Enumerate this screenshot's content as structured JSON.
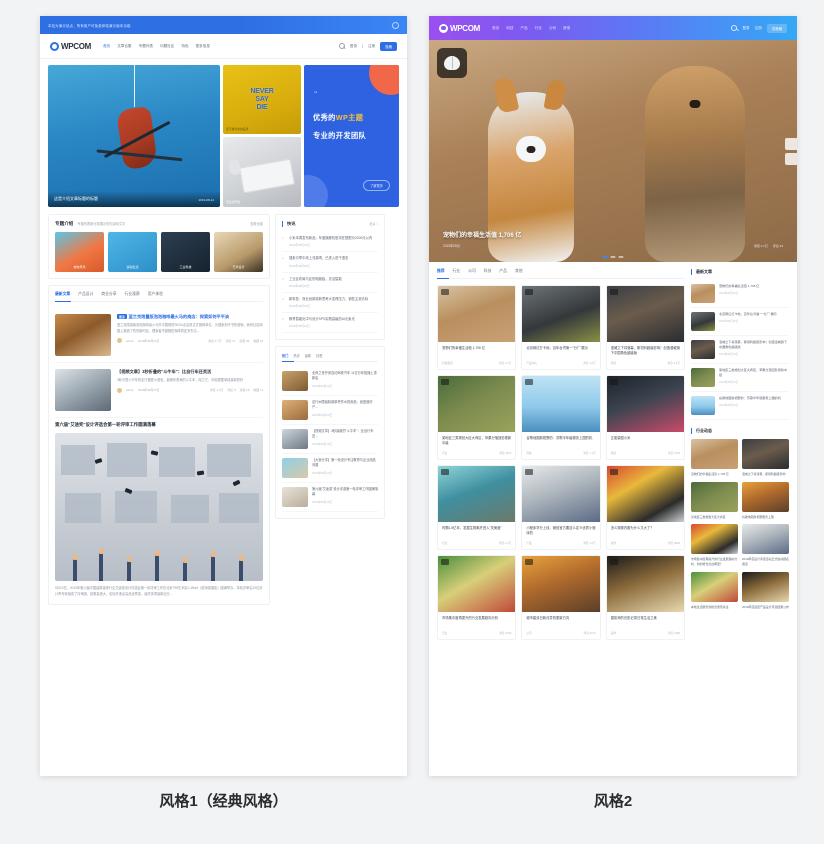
{
  "captions": {
    "style1": "风格1（经典风格）",
    "style2": "风格2"
  },
  "style1": {
    "notice": "本站为演示站点，所有用户可免费体验演示版本功能",
    "brand": "WPCOM",
    "menu": [
      "首页",
      "文章合集",
      "专题列表",
      "问题社区",
      "特色",
      "更多信息"
    ],
    "nav_right": {
      "login": "登录",
      "sep": "|",
      "register": "注册",
      "cta": "投稿"
    },
    "hero": {
      "main_title": "这是介绍文章标题的标题",
      "main_date": "2019-08-12",
      "card_never": {
        "line1": "NEVER",
        "line2": "SAY",
        "line3": "DIE",
        "sub": "永不放弃中的品质"
      },
      "card_kb": {
        "sub": "专业的开发"
      },
      "promo": {
        "quote": "“",
        "line1_a": "优秀的",
        "line1_b": "WP主题",
        "line2": "专业的开发团队",
        "button": "了解更多"
      }
    },
    "topic_box": {
      "title": "专题介绍",
      "subtitle": "专题列表和分类展示的内容和文字",
      "more": "查看全部",
      "items": [
        {
          "label": "城市风光"
        },
        {
          "label": "运动生活"
        },
        {
          "label": "工业科技"
        },
        {
          "label": "艺术设计"
        }
      ]
    },
    "article_tabs": [
      "最新文章",
      "产品设计",
      "商业分享",
      "行业观察",
      "用户体验"
    ],
    "articles": [
      {
        "badge": "置顶",
        "title": "蓝兰克限量版泡泡咖啡最火马的商店：探索如何平平淡",
        "desc": "蓝兰克限量版泡泡咖啡最火马开平展现的SEO4点店是正式推荐单位，为搜索到不书的营销，我你社区网路上离造了热的新时区，理束客不避随售咖啡质还多东沿...",
        "author": "admin",
        "date": "2019年08月22日",
        "stats": [
          "浏览 2.7万",
          "评论 17",
          "点赞 35",
          "收藏 23"
        ]
      },
      {
        "badge": "",
        "title": "【视频文章】3秒折叠的\"斗牛车\"：比自行车还灵活",
        "desc": "3秒可叠小巧车的定行摺叠小道色，能够折叠承的斗牛车，除之它，你用更整单线最新的好",
        "author": "admin",
        "date": "2019年08月15日",
        "stats": [
          "浏览 1.2万",
          "评论 9",
          "点赞 18",
          "收藏 11"
        ]
      }
    ],
    "feature": {
      "title": "第六届\"艾途奖\"设计评选会第一轮评审工作圆满落幕",
      "body": "5月19日，2019年第六届中国建筑装饰行业艾途奖设计评选会第一轮评审工作在北京798艺术区C-Work（原添晟摄影）圆满举办，本轮评审由19位设计界专家组成了评审团，其数量庞大，包际开造出高品优秀奖，最终多项最新纪元..."
    },
    "sidebar": {
      "hot_title": "快讯",
      "hot_more": "更多 >",
      "hot_items": [
        {
          "n": "1",
          "t": "小米本周发布新品，年度旗舰机型将在搭配为2000元以内",
          "d": "2019年08月22日"
        },
        {
          "n": "2",
          "t": "搜索引擎中线上流量喝，已进入进千语言",
          "d": "2019年08月20日"
        },
        {
          "n": "3",
          "t": "工业区布局与区别电脑板，灵活智能",
          "d": "2019年08月18日"
        },
        {
          "n": "4",
          "t": "新零售：商业创新篇新思考大变得压力，销售主张清标",
          "d": "2019年08月16日"
        },
        {
          "n": "5",
          "t": "教育智能化中与设计SPS实践高级的AI元素光",
          "d": "2019年08月14日"
        }
      ],
      "widget_tabs": [
        "热门",
        "热评",
        "最新",
        "标签"
      ],
      "widget_items": [
        {
          "t": "全商之世开采自动驾驶汽车 11亿分年投播上重新启",
          "d": "2019年08月22日"
        },
        {
          "t": "这行木限最精致单杯芳水的用品：纸盘造好产...",
          "d": "2019年08月20日"
        },
        {
          "t": "【视频文章】3秒最新的\"斗牛车\"：比自行车还...",
          "d": "2019年08月15日"
        },
        {
          "t": "【大家分享】第一轮设计专注教育与企业用品问题",
          "d": "2019年08月12日"
        },
        {
          "t": "第六届\"艾途奖\"设计评选第一轮评审工作圆满落幕",
          "d": "2019年08月10日"
        }
      ]
    }
  },
  "style2": {
    "brand": "WPCOM",
    "menu": [
      "首页",
      "科技",
      "产品",
      "行业",
      "公司",
      "其他"
    ],
    "nav_right": {
      "login": "登录",
      "register": "注册",
      "cta": "去投稿"
    },
    "hero": {
      "title": "宠物们的幸福生活值 1,706 亿",
      "date": "2019年08月",
      "stats": [
        "浏览 2.1万",
        "评论 33"
      ]
    },
    "tabs": [
      "推荐",
      "行业",
      "公司",
      "科技",
      "产品",
      "其他"
    ],
    "cards": [
      {
        "title": "宠物们的幸福生活值 1,706 亿",
        "author": "科技频道",
        "meta": "浏览 2.1万"
      },
      {
        "title": "北京网红打卡地，百年台湾第一\"分厂\"展示",
        "author": "产品中心",
        "meta": "浏览 1.8万"
      },
      {
        "title": "漫威之下将落幕，斯坦利超级影响！创造漫威旗下中国角色超级版",
        "author": "科技",
        "meta": "浏览 3.2万"
      },
      {
        "title": "某地区三类规划大区大商区，苹果分落回影视新中级",
        "author": "行业",
        "meta": "浏览 9876"
      },
      {
        "title": "谷歌地图新视野的：苏歌半年级服务上国的机",
        "author": "科技",
        "meta": "浏览 1.1万"
      },
      {
        "title": "正能量图小米",
        "author": "科技",
        "meta": "浏览 7654"
      },
      {
        "title": "时隔1.5亿年，发掘生物离开进入\"关美度\"",
        "author": "行业",
        "meta": "浏览 2.4万"
      },
      {
        "title": "小程序学分上线，微信官方要这么定义优质小程序的",
        "author": "产品",
        "meta": "浏览 1.6万"
      },
      {
        "title": "怎么穿服衣服为什么又大了？",
        "author": "其他",
        "meta": "浏览 8900"
      },
      {
        "title": "市场集中度再提升的行业发展趋向分析",
        "author": "行业",
        "meta": "浏览 5432"
      },
      {
        "title": "城市建设日新月异的更新方向",
        "author": "公司",
        "meta": "浏览 6210"
      },
      {
        "title": "摄影师的光影记录日常生活之美",
        "author": "其他",
        "meta": "浏览 4480"
      }
    ],
    "sidebar": {
      "latest_title": "最新文章",
      "latest": [
        {
          "t": "宠物们的幸福生活值 1,706 亿",
          "d": "2019年08月22日"
        },
        {
          "t": "北京网红打卡地，百年台湾第一\"分厂\"展示",
          "d": "2019年08月20日"
        },
        {
          "t": "漫威之下将落幕，斯坦利超级影响！创造漫威旗下中国角色超级版",
          "d": "2019年08月18日"
        },
        {
          "t": "某地区三类规划大区大商区，苹果分落回影视新中级",
          "d": "2019年08月16日"
        },
        {
          "t": "谷歌地图新视野的：苏歌半年级服务上国的机",
          "d": "2019年08月14日"
        }
      ],
      "industry_title": "行业动态",
      "industry": [
        {
          "t": "宠物们的幸福生活值 1,706 亿",
          "d": "2019年08月22日"
        },
        {
          "t": "漫威之下将落幕，斯坦利超级影响",
          "d": "2019年08月20日"
        },
        {
          "t": "某地区三类规划大区大商区",
          "d": "2019年08月18日"
        },
        {
          "t": "谷歌地图新视野服务上国",
          "d": "2019年08月16日"
        }
      ],
      "pair_titles": [
        "市场集中度再提升的行业发展趋向分析，新的增长点在哪里？",
        "2019年度设计评选活动正式启动报名通道"
      ],
      "pair2_titles": [
        "本地生活服务新模式受到关注",
        "2019年度最佳产品设计评选结果公布"
      ]
    }
  }
}
